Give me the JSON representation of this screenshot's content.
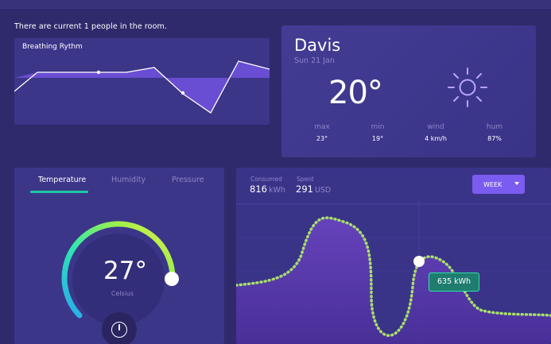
{
  "header": {
    "people_text": "There are current 1 people in the room."
  },
  "breathing": {
    "title": "Breathing Rythm",
    "color_line": "#ffffff",
    "color_fill": "#6c4fd6"
  },
  "weather": {
    "city": "Davis",
    "date": "Sun 21 Jan",
    "temperature": "20°",
    "icon": "sun-icon",
    "stats": [
      {
        "label": "max",
        "value": "23°"
      },
      {
        "label": "min",
        "value": "19°"
      },
      {
        "label": "wind",
        "value": "4 km/h"
      },
      {
        "label": "hum",
        "value": "87%"
      }
    ]
  },
  "thermostat": {
    "tabs": [
      "Temperature",
      "Humidity",
      "Pressure"
    ],
    "active_tab": "Temperature",
    "temperature": "27°",
    "unit": "Celsius",
    "power_icon": "power-icon",
    "accent": "#1ec8a5"
  },
  "energy": {
    "consumed_label": "Consumed",
    "consumed_value": "816",
    "consumed_unit": "kWh",
    "spent_label": "Spent",
    "spent_value": "291",
    "spent_unit": "USD",
    "period_button": "WEEK",
    "tooltip": "635 kWh",
    "line_color": "#a8e06a",
    "fill_color": "#5b3aa6"
  }
}
